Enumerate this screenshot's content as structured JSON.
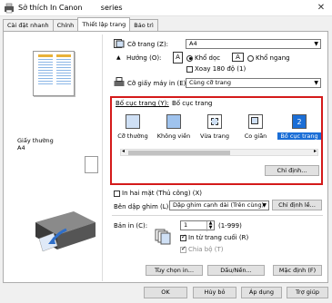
{
  "window": {
    "title": "Sở thích In Canon",
    "title_suffix": "series",
    "close": "✕"
  },
  "tabs": [
    "Cài đặt nhanh",
    "Chính",
    "Thiết lập trang",
    "Bảo trì"
  ],
  "preview": {
    "paper_label_1": "Giấy thường",
    "paper_label_2": "A4"
  },
  "page_size": {
    "label": "Cỡ trang (Z):",
    "value": "A4"
  },
  "orientation": {
    "label": "Hướng (O):",
    "options": [
      "Khổ dọc",
      "Khổ ngang"
    ],
    "rotate_label": "Xoay 180 độ (1)"
  },
  "printer_paper_size": {
    "label": "Cỡ giấy máy in (E):",
    "value": "Cùng cỡ trang"
  },
  "page_layout": {
    "label": "Bố cục trang (Y):",
    "current": "Bố cục trang",
    "options": [
      {
        "label": "Cỡ thường",
        "icon": "normal-size-icon"
      },
      {
        "label": "Không viền",
        "icon": "borderless-icon"
      },
      {
        "label": "Vừa trang",
        "icon": "fit-to-page-icon"
      },
      {
        "label": "Co giãn",
        "icon": "scaled-icon"
      },
      {
        "label": "Bố cục trang",
        "icon": "page-layout-icon",
        "badge": "2"
      }
    ],
    "specify_button": "Chỉ định..."
  },
  "duplex": {
    "label": "In hai mặt (Thủ công) (X)"
  },
  "stapling": {
    "label": "Bên dập ghim (L):",
    "value": "Dập ghim cạnh dài (Trên cùng)",
    "button": "Chỉ định lề..."
  },
  "copies": {
    "label": "Bản in (C):",
    "value": "1",
    "range": "(1-999)",
    "reverse_label": "In từ trang cuối (R)",
    "collate_label": "Chia bộ (T)"
  },
  "bottom_buttons": {
    "options": "Tùy chọn in...",
    "stamp": "Dấu/Nền...",
    "defaults": "Mặc định (F)"
  },
  "footer": {
    "ok": "OK",
    "cancel": "Hủy bỏ",
    "apply": "Áp dụng",
    "help": "Trợ giúp"
  },
  "colors": {
    "highlight": "#d41a1a",
    "selection": "#1b6ed6"
  }
}
